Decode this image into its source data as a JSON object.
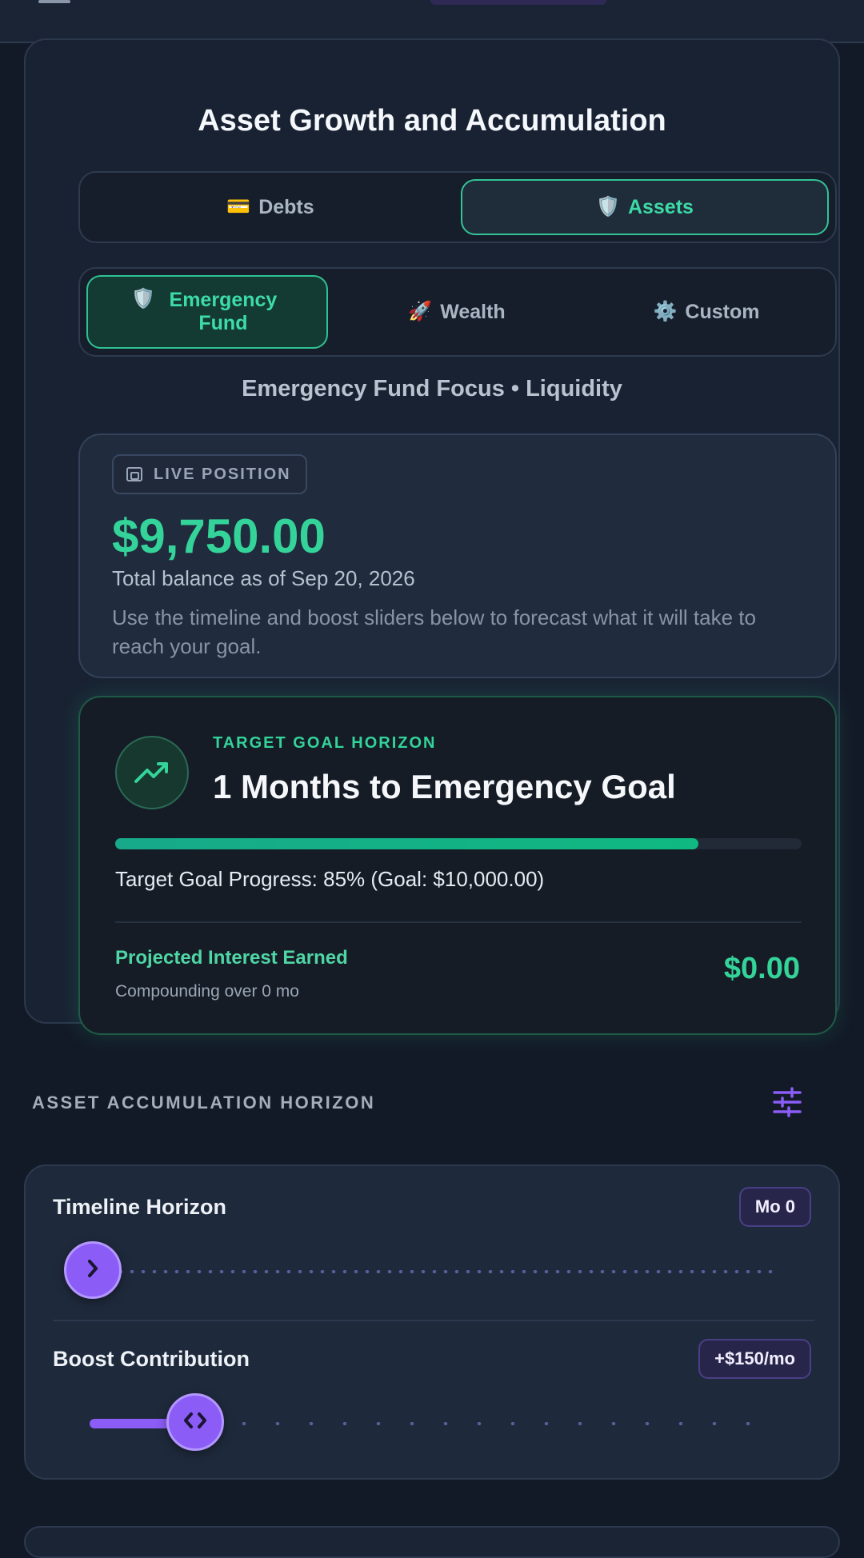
{
  "page": {
    "title": "Asset Growth and Accumulation",
    "subtitle": "Emergency Fund Focus • Liquidity"
  },
  "tabs": [
    {
      "label": "Debts",
      "emoji": "💳",
      "active": false
    },
    {
      "label": "Assets",
      "emoji": "🛡️",
      "active": true
    }
  ],
  "subtabs": [
    {
      "label": "Emergency Fund",
      "emoji": "🛡️",
      "active": true
    },
    {
      "label": "Wealth",
      "emoji": "🚀",
      "active": false
    },
    {
      "label": "Custom",
      "emoji": "⚙️",
      "active": false
    }
  ],
  "live": {
    "badge": "LIVE POSITION",
    "amount": "$9,750.00",
    "date_text": "Total balance as of Sep 20, 2026",
    "description": "Use the timeline and boost sliders below to forecast what it will take to reach your goal."
  },
  "goal": {
    "eyebrow": "TARGET GOAL HORIZON",
    "title": "1 Months to Emergency Goal",
    "progress_percent": 85,
    "progress_text": "Target Goal Progress: 85% (Goal: $10,000.00)",
    "interest_label": "Projected Interest Earned",
    "interest_sub": "Compounding over 0 mo",
    "interest_value": "$0.00"
  },
  "horizon": {
    "section_label": "ASSET ACCUMULATION HORIZON",
    "timeline": {
      "label": "Timeline Horizon",
      "value_text": "Mo 0",
      "fraction": 0.0
    },
    "boost": {
      "label": "Boost Contribution",
      "value_text": "+$150/mo",
      "fraction": 0.15
    }
  },
  "colors": {
    "accent_green": "#34d399",
    "accent_purple": "#8b5cf6",
    "background": "#131a27"
  },
  "icons": {
    "live_badge": "wallet-icon",
    "goal": "trending-up-icon",
    "section": "tune-sliders-icon",
    "timeline_thumb": "chevron-right-icon",
    "boost_thumb": "code-arrows-icon"
  }
}
